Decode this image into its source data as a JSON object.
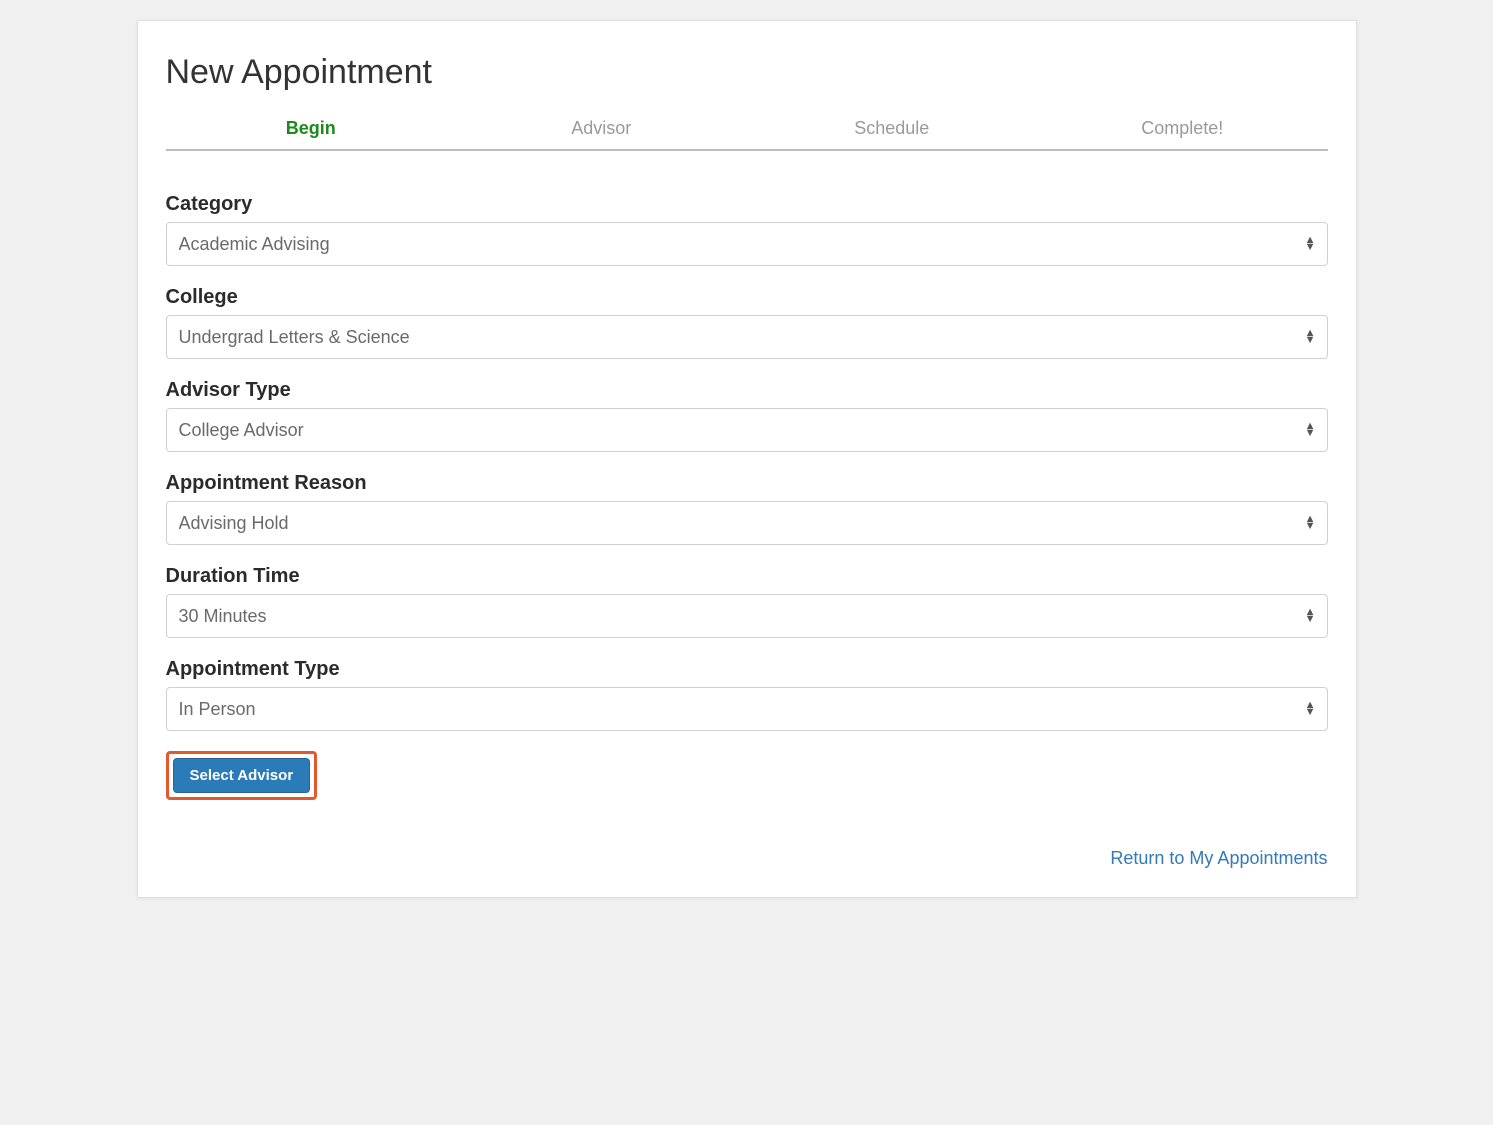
{
  "page": {
    "title": "New Appointment"
  },
  "tabs": [
    {
      "label": "Begin",
      "active": true
    },
    {
      "label": "Advisor",
      "active": false
    },
    {
      "label": "Schedule",
      "active": false
    },
    {
      "label": "Complete!",
      "active": false
    }
  ],
  "fields": {
    "category": {
      "label": "Category",
      "value": "Academic Advising"
    },
    "college": {
      "label": "College",
      "value": "Undergrad Letters & Science"
    },
    "advisor_type": {
      "label": "Advisor Type",
      "value": "College Advisor"
    },
    "appointment_reason": {
      "label": "Appointment Reason",
      "value": "Advising Hold"
    },
    "duration_time": {
      "label": "Duration Time",
      "value": "30 Minutes"
    },
    "appointment_type": {
      "label": "Appointment Type",
      "value": "In Person"
    }
  },
  "actions": {
    "select_advisor_label": "Select Advisor"
  },
  "links": {
    "return_label": "Return to My Appointments"
  }
}
